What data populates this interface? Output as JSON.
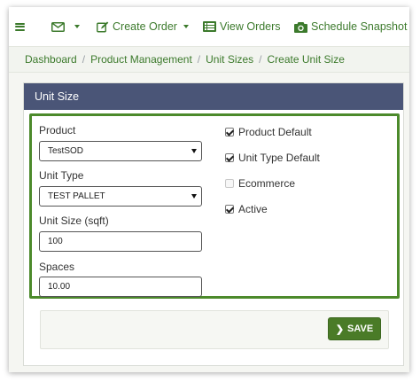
{
  "nav": {
    "create_order": "Create Order",
    "view_orders": "View Orders",
    "schedule_snapshot": "Schedule Snapshot"
  },
  "breadcrumb": [
    "Dashboard",
    "Product Management",
    "Unit Sizes",
    "Create Unit Size"
  ],
  "panel": {
    "title": "Unit Size"
  },
  "form": {
    "product_label": "Product",
    "product_value": "TestSOD",
    "unit_type_label": "Unit Type",
    "unit_type_value": "TEST PALLET",
    "unit_size_label": "Unit Size (sqft)",
    "unit_size_value": "100",
    "spaces_label": "Spaces",
    "spaces_value": "10.00",
    "checkboxes": [
      {
        "label": "Product Default",
        "checked": true
      },
      {
        "label": "Unit Type Default",
        "checked": true
      },
      {
        "label": "Ecommerce",
        "checked": false
      },
      {
        "label": "Active",
        "checked": true
      }
    ]
  },
  "actions": {
    "save_label": "SAVE"
  },
  "colors": {
    "accent_green": "#3c7a2c",
    "panel_header": "#4a5577",
    "save_button": "#4a7b27",
    "highlight_border": "#4c8a2b"
  }
}
